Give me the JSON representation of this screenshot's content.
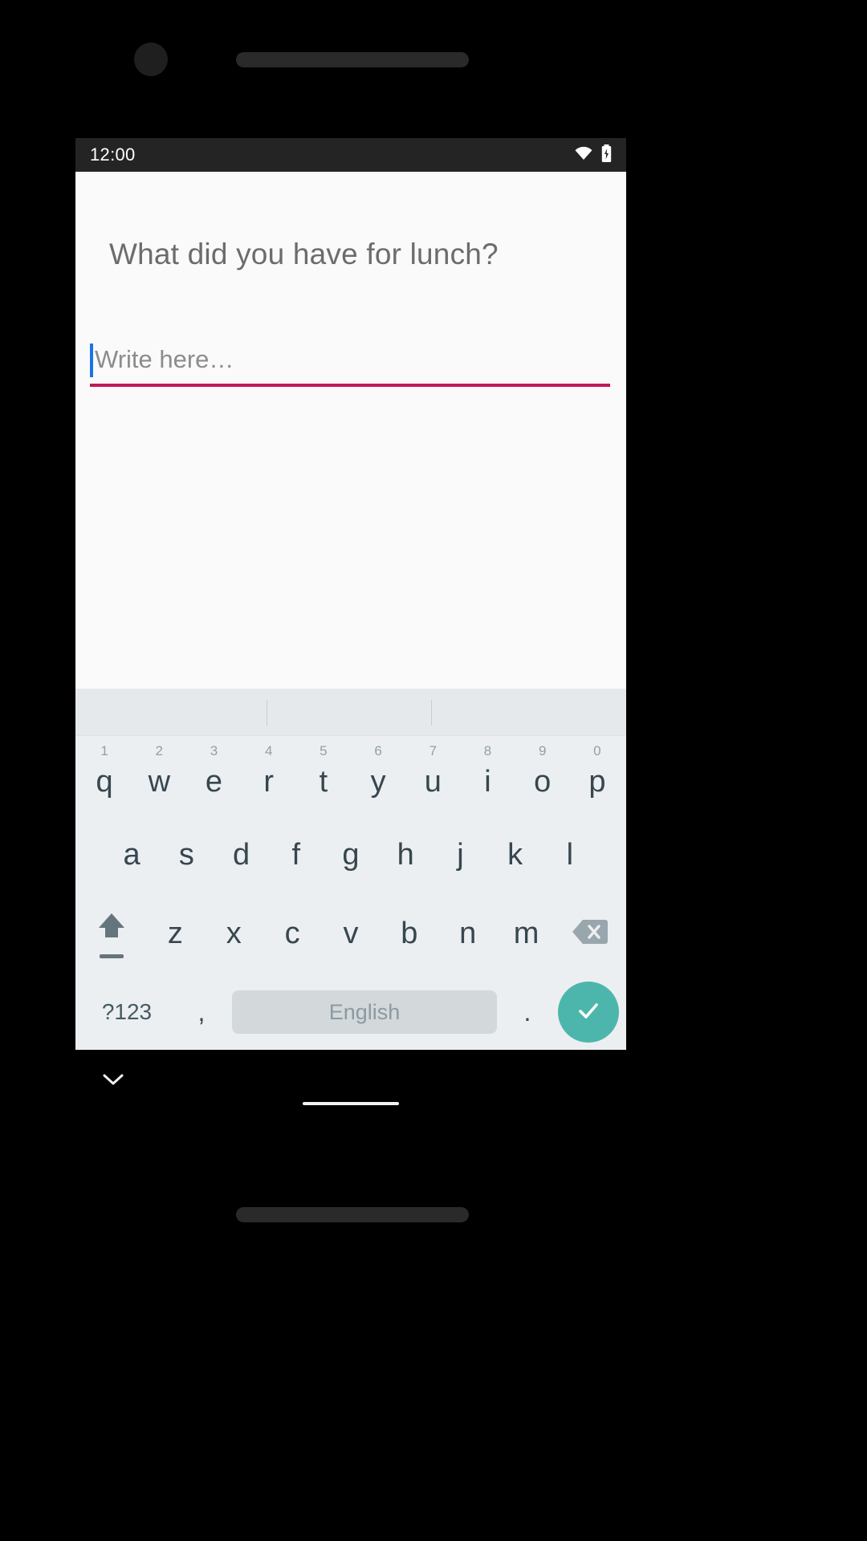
{
  "device": {
    "camera_icon": "camera-dot",
    "speaker_bar_icon": "speaker-grille"
  },
  "status_bar": {
    "time": "12:00",
    "icons": [
      "wifi-icon",
      "battery-icon"
    ],
    "background": "#242424",
    "text_color": "#ffffff"
  },
  "content": {
    "question": "What did you have for lunch?",
    "input": {
      "value": "",
      "placeholder": "Write here…",
      "caret_color": "#1a73e8",
      "underline_color": "#c2185b"
    },
    "background": "#fafafa"
  },
  "keyboard": {
    "background": "#eceff1",
    "suggestion_strip": {
      "suggestions": [
        "",
        "",
        ""
      ],
      "divider_count": 2
    },
    "row1": [
      {
        "label": "q",
        "hint": "1"
      },
      {
        "label": "w",
        "hint": "2"
      },
      {
        "label": "e",
        "hint": "3"
      },
      {
        "label": "r",
        "hint": "4"
      },
      {
        "label": "t",
        "hint": "5"
      },
      {
        "label": "y",
        "hint": "6"
      },
      {
        "label": "u",
        "hint": "7"
      },
      {
        "label": "i",
        "hint": "8"
      },
      {
        "label": "o",
        "hint": "9"
      },
      {
        "label": "p",
        "hint": "0"
      }
    ],
    "row2": [
      {
        "label": "a"
      },
      {
        "label": "s"
      },
      {
        "label": "d"
      },
      {
        "label": "f"
      },
      {
        "label": "g"
      },
      {
        "label": "h"
      },
      {
        "label": "j"
      },
      {
        "label": "k"
      },
      {
        "label": "l"
      }
    ],
    "row3": {
      "shift_icon": "shift-arrow-icon",
      "letters": [
        {
          "label": "z"
        },
        {
          "label": "x"
        },
        {
          "label": "c"
        },
        {
          "label": "v"
        },
        {
          "label": "b"
        },
        {
          "label": "n"
        },
        {
          "label": "m"
        }
      ],
      "backspace_icon": "backspace-icon"
    },
    "row4": {
      "symbols_label": "?123",
      "comma_label": ",",
      "space_label": "English",
      "period_label": ".",
      "enter_icon": "check-icon",
      "enter_color": "#4db6ac"
    }
  },
  "nav": {
    "hide_keyboard_icon": "chevron-down-icon",
    "home_indicator": "home-indicator"
  }
}
